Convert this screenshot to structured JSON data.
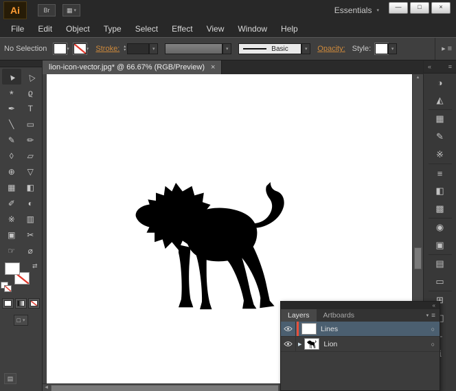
{
  "titlebar": {
    "logo": "Ai",
    "bridge_label": "Br",
    "workspace": "Essentials",
    "window_controls": [
      {
        "name": "minimize",
        "glyph": "—"
      },
      {
        "name": "maximize",
        "glyph": "□"
      },
      {
        "name": "close",
        "glyph": "×"
      }
    ]
  },
  "menubar": {
    "items": [
      "File",
      "Edit",
      "Object",
      "Type",
      "Select",
      "Effect",
      "View",
      "Window",
      "Help"
    ]
  },
  "control_bar": {
    "selection_status": "No Selection",
    "stroke_label": "Stroke:",
    "stroke_weight_value": "",
    "brush_name": "Basic",
    "opacity_label": "Opacity:",
    "style_label": "Style:"
  },
  "doc_tab": {
    "title": "lion-icon-vector.jpg* @ 66.67% (RGB/Preview)"
  },
  "tools": [
    {
      "name": "selection-tool",
      "glyph": "▲"
    },
    {
      "name": "direct-selection-tool",
      "glyph": "△"
    },
    {
      "name": "magic-wand-tool",
      "glyph": "*"
    },
    {
      "name": "lasso-tool",
      "glyph": "ϱ"
    },
    {
      "name": "pen-tool",
      "glyph": "✒"
    },
    {
      "name": "type-tool",
      "glyph": "T"
    },
    {
      "name": "line-segment-tool",
      "glyph": "╲"
    },
    {
      "name": "rectangle-tool",
      "glyph": "▭"
    },
    {
      "name": "paintbrush-tool",
      "glyph": "✎"
    },
    {
      "name": "pencil-tool",
      "glyph": "✏"
    },
    {
      "name": "width-tool",
      "glyph": "◊"
    },
    {
      "name": "free-transform-tool",
      "glyph": "▱"
    },
    {
      "name": "shape-builder-tool",
      "glyph": "⊕"
    },
    {
      "name": "perspective-grid-tool",
      "glyph": "▽"
    },
    {
      "name": "mesh-tool",
      "glyph": "▦"
    },
    {
      "name": "gradient-tool",
      "glyph": "◧"
    },
    {
      "name": "eyedropper-tool",
      "glyph": "✐"
    },
    {
      "name": "blend-tool",
      "glyph": "◐"
    },
    {
      "name": "symbol-sprayer-tool",
      "glyph": "※"
    },
    {
      "name": "column-graph-tool",
      "glyph": "▥"
    },
    {
      "name": "artboard-tool",
      "glyph": "▣"
    },
    {
      "name": "slice-tool",
      "glyph": "✂"
    },
    {
      "name": "hand-tool",
      "glyph": "☞"
    },
    {
      "name": "zoom-tool",
      "glyph": "⌀"
    }
  ],
  "right_dock": {
    "icons": [
      {
        "name": "color-panel",
        "glyph": "◑"
      },
      {
        "name": "color-guide-panel",
        "glyph": "◭"
      },
      {
        "name": "swatches-panel",
        "glyph": "▦"
      },
      {
        "name": "brushes-panel",
        "glyph": "✎"
      },
      {
        "name": "symbols-panel",
        "glyph": "※"
      },
      {
        "name": "stroke-panel",
        "glyph": "≡"
      },
      {
        "name": "gradient-panel",
        "glyph": "◧"
      },
      {
        "name": "transparency-panel",
        "glyph": "▩"
      },
      {
        "name": "appearance-panel",
        "glyph": "◉"
      },
      {
        "name": "graphic-styles-panel",
        "glyph": "▣"
      },
      {
        "name": "layers-panel-icon",
        "glyph": "▤"
      },
      {
        "name": "artboards-panel",
        "glyph": "▭"
      },
      {
        "name": "align-panel",
        "glyph": "⊞"
      },
      {
        "name": "pathfinder-panel",
        "glyph": "◰"
      },
      {
        "name": "navigator-panel",
        "glyph": "+"
      },
      {
        "name": "info-panel",
        "glyph": "ℹ"
      }
    ]
  },
  "layers_panel": {
    "tabs": {
      "layers": "Layers",
      "artboards": "Artboards"
    },
    "rows": [
      {
        "name": "Lines"
      },
      {
        "name": "Lion"
      }
    ]
  },
  "icons": {
    "caret_down": "▾",
    "caret_up": "▴",
    "chevrons": "«",
    "menu": "≡",
    "swap": "⇄",
    "scroll_up": "▲",
    "scroll_down": "▼",
    "scroll_left": "◀",
    "scroll_right": "▶",
    "target": "○",
    "disclosure": "▶",
    "tab_close": "×",
    "screen_mode": "□"
  },
  "colors": {
    "logo_orange": "#ff9c33",
    "link_orange": "#cf8a3b",
    "selected_layer_blue": "#4b5f70",
    "layer_accent_red": "#e8503a",
    "stroke_none_red": "#e03326",
    "artboard_white": "#ffffff",
    "lion_black": "#000000"
  }
}
